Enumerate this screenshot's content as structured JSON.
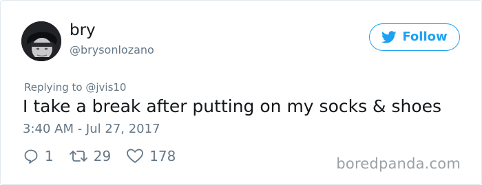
{
  "user": {
    "display_name": "bry",
    "handle": "@brysonlozano"
  },
  "follow_button": {
    "label": "Follow",
    "icon": "twitter-bird-icon",
    "color": "#1da1f2"
  },
  "tweet": {
    "replying_prefix": "Replying to",
    "replying_to": "@jvis10",
    "text": "I take a break after putting on my socks & shoes",
    "timestamp": "3:40 AM - Jul 27, 2017"
  },
  "actions": {
    "reply_count": "1",
    "retweet_count": "29",
    "like_count": "178",
    "reply_icon": "reply-bubble-icon",
    "retweet_icon": "retweet-icon",
    "like_icon": "heart-icon"
  },
  "watermark": {
    "text": "boredpanda.com"
  }
}
